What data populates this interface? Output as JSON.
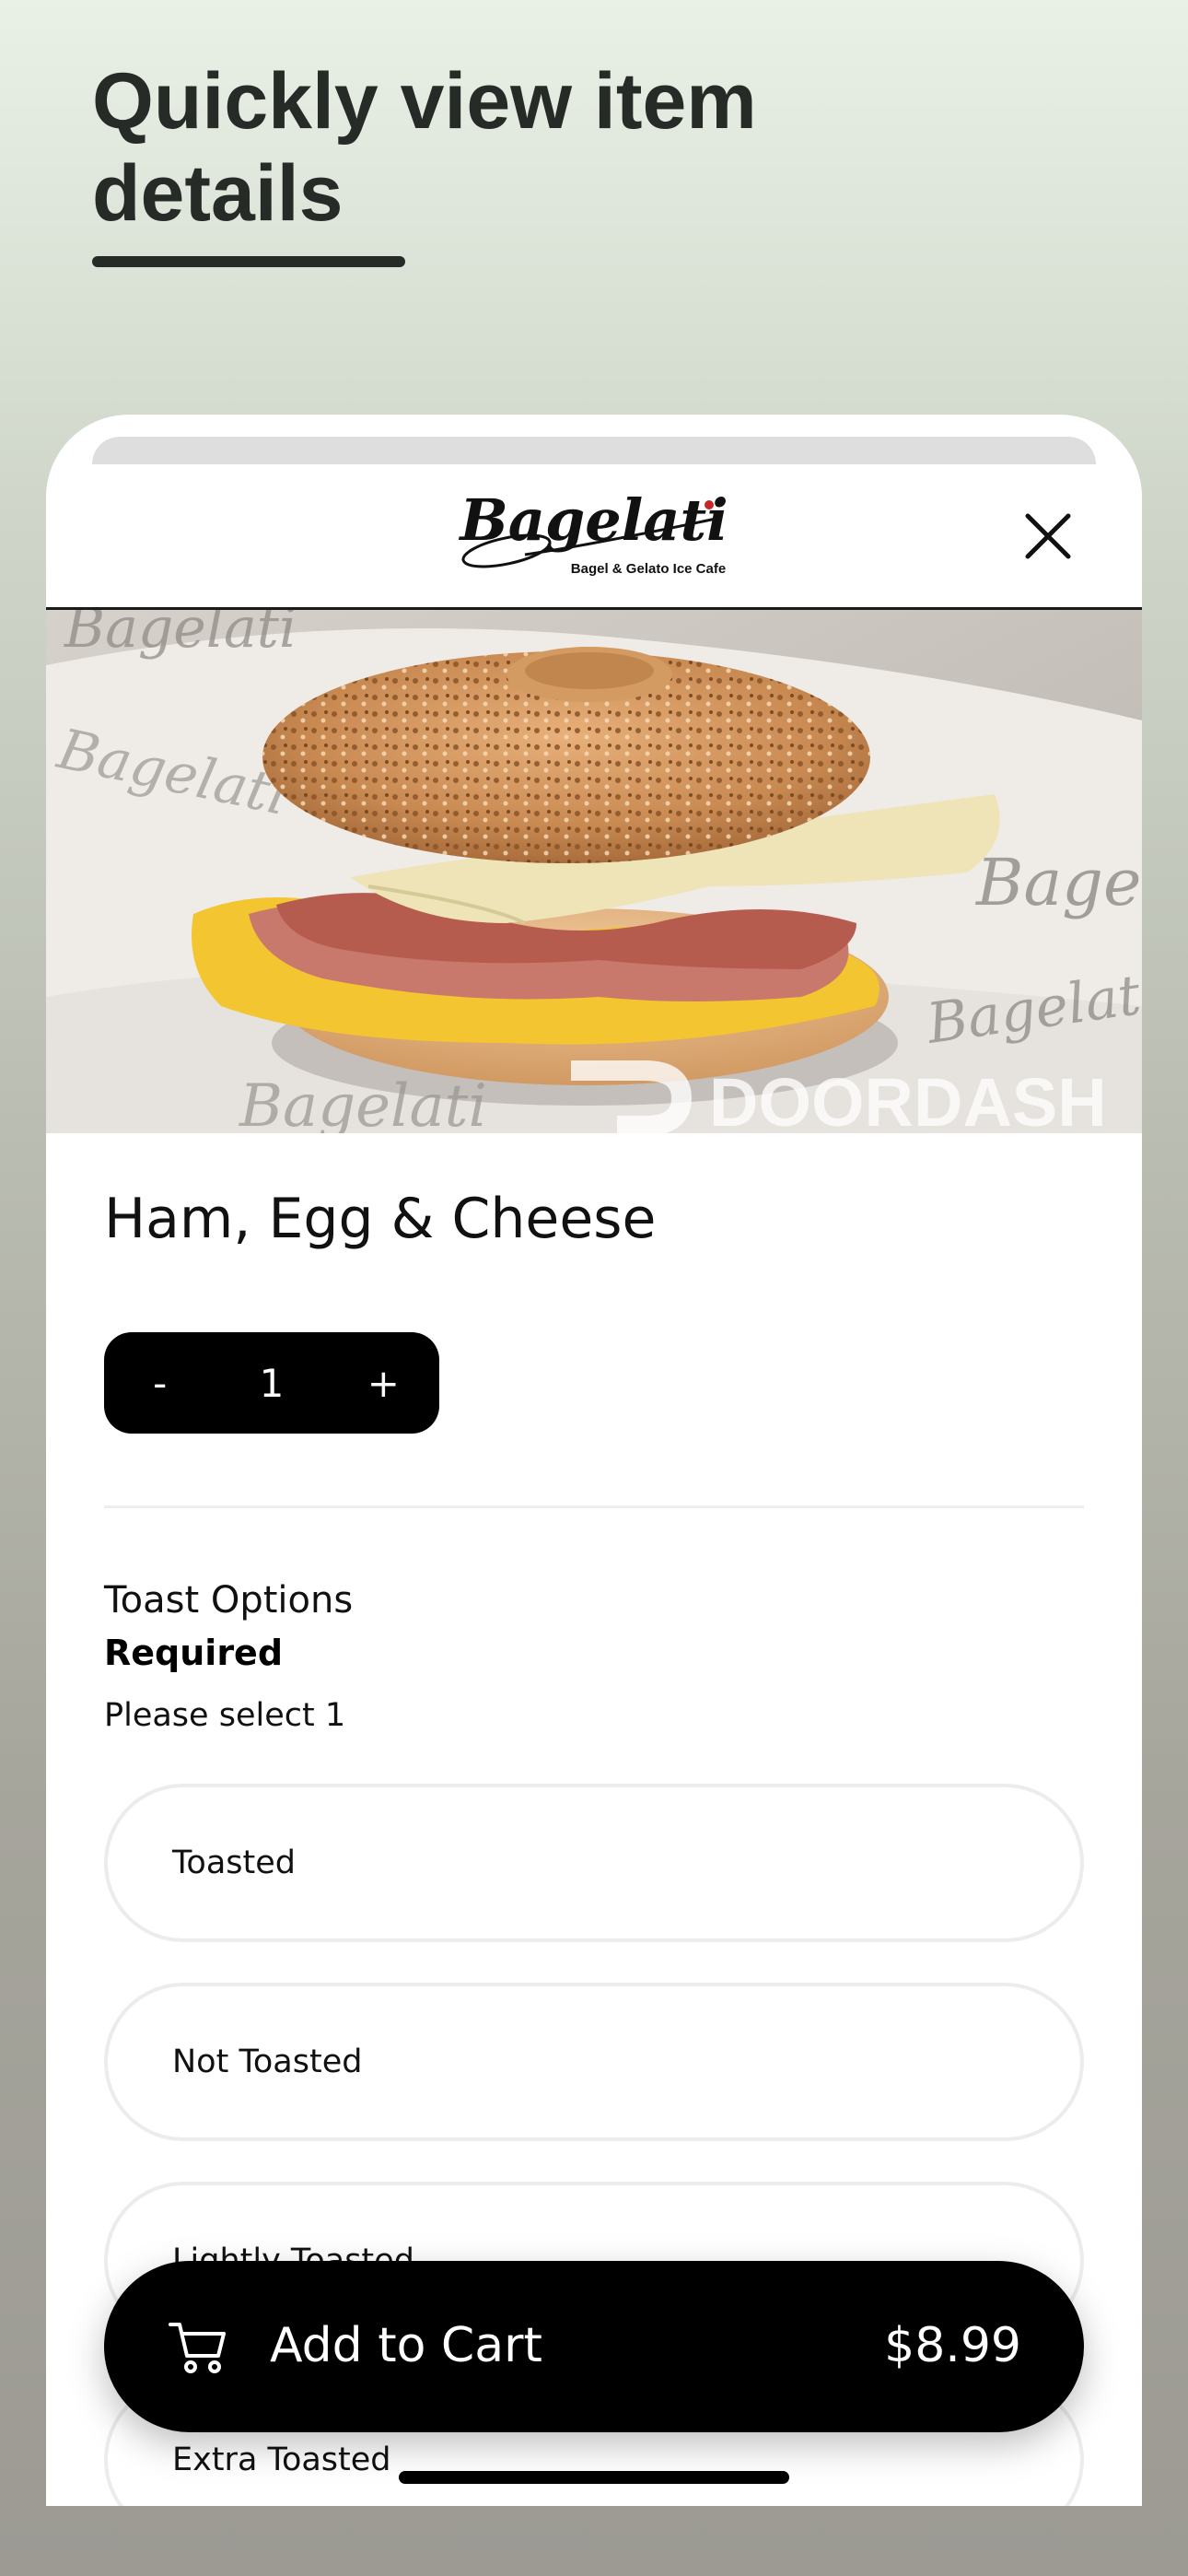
{
  "caption": {
    "line1": "Quickly view item",
    "line2": "details"
  },
  "header": {
    "logo_text": "Bagelati",
    "logo_tagline": "Bagel & Gelato Ice Cafe",
    "close_icon": "close-icon"
  },
  "hero": {
    "watermark": "DOORDASH",
    "paper_print": "Bagelati"
  },
  "item": {
    "title": "Ham, Egg & Cheese"
  },
  "quantity": {
    "minus": "-",
    "value": "1",
    "plus": "+"
  },
  "options_group": {
    "title": "Toast Options",
    "required": "Required",
    "hint": "Please select 1",
    "options": [
      "Toasted",
      "Not Toasted",
      "Lightly Toasted",
      "Extra Toasted"
    ]
  },
  "cart": {
    "label": "Add to Cart",
    "price": "$8.99",
    "icon": "cart-icon"
  },
  "colors": {
    "accent": "#000000",
    "option_border": "#ececec",
    "headline": "#262b28"
  }
}
